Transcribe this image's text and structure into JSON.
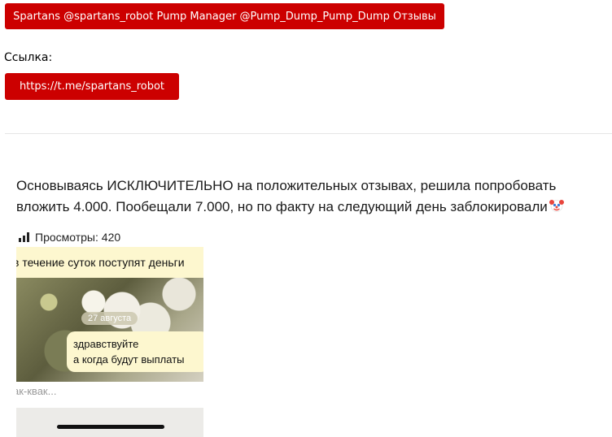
{
  "header": {
    "title_button": "Spartans @spartans_robot Pump Manager @Pump_Dump_Pump_Dump Отзывы"
  },
  "link_section": {
    "label": "Ссылка:",
    "link_button": "https://t.me/spartans_robot"
  },
  "review": {
    "text": "Основываясь ИСКЛЮЧИТЕЛЬНО на положительных отзывах, решила попробовать вложить 4.000. Пообещали 7.000, но по факту на следующий день заблокировали",
    "emoji_icon": "clown-face-icon",
    "views_label": "Просмотры: 420"
  },
  "screenshot": {
    "banner_text": "в течение суток поступят деньги",
    "date_pill": "27 августа",
    "bubble_line1": "здравствуйте",
    "bubble_line2": "а когда будут выплаты",
    "preview_text": "ак-квак..."
  },
  "colors": {
    "accent_red": "#cc0000",
    "bubble_yellow": "#fdf7cf"
  }
}
